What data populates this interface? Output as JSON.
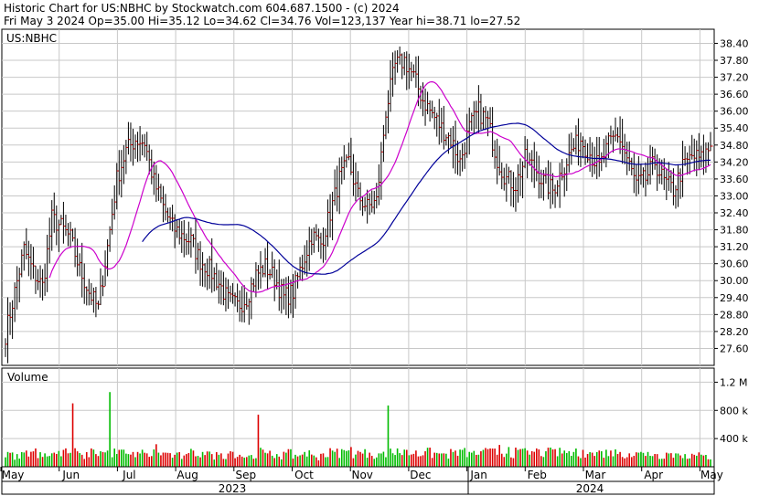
{
  "header": {
    "line1": "Historic Chart for US:NBHC by Stockwatch.com 604.687.1500 - (c) 2024",
    "line2": "Fri May  3 2024   Op=35.00  Hi=35.12  Lo=34.62  Cl=34.76  Vol=123,137  Year hi=38.71  lo=27.52"
  },
  "price_panel": {
    "label": "US:NBHC"
  },
  "volume_panel": {
    "label": "Volume"
  },
  "colors": {
    "bar": "#000000",
    "bar_tick": "#cc0000",
    "ma_short": "#cc00cc",
    "ma_long": "#000099",
    "vol_up": "#00bb00",
    "vol_down": "#dd0000",
    "grid": "#c8c8c8",
    "frame": "#000000"
  },
  "chart_data": [
    {
      "type": "line",
      "subtype": "ohlc-bars-with-moving-averages",
      "ylim": [
        27.0,
        38.9
      ],
      "y_ticks": [
        "38.40",
        "37.80",
        "37.20",
        "36.60",
        "36.00",
        "35.40",
        "34.80",
        "34.20",
        "33.60",
        "33.00",
        "32.40",
        "31.80",
        "31.20",
        "30.60",
        "30.00",
        "29.40",
        "28.80",
        "28.20",
        "27.60"
      ],
      "x_ticks": [
        "May",
        "Jun",
        "Jul",
        "Aug",
        "Sep",
        "Oct",
        "Nov",
        "Dec",
        "Jan",
        "Feb",
        "Mar",
        "Apr",
        "May"
      ],
      "year_labels": [
        "2023",
        "2024"
      ],
      "grid": true,
      "weekly_closes": [
        28.1,
        29.6,
        31.1,
        30.3,
        29.8,
        32.2,
        31.9,
        31.5,
        30.4,
        29.6,
        29.0,
        31.2,
        33.6,
        34.6,
        35.0,
        34.9,
        33.5,
        32.6,
        31.9,
        31.6,
        31.4,
        30.7,
        30.4,
        29.9,
        29.3,
        29.1,
        29.4,
        30.2,
        30.5,
        30.1,
        29.4,
        29.6,
        30.6,
        31.6,
        31.3,
        32.4,
        33.6,
        34.2,
        33.0,
        32.6,
        32.8,
        36.0,
        37.6,
        37.8,
        37.2,
        36.4,
        35.9,
        35.4,
        35.0,
        34.2,
        35.4,
        36.0,
        35.6,
        34.3,
        33.6,
        33.4,
        34.3,
        34.0,
        33.5,
        33.2,
        33.9,
        34.6,
        35.0,
        34.5,
        34.0,
        34.8,
        35.2,
        34.3,
        33.4,
        33.6,
        34.2,
        33.5,
        33.2,
        34.0,
        34.4,
        34.3,
        34.76
      ],
      "volume_k": [
        210,
        180,
        230,
        260,
        190,
        200,
        240,
        900,
        170,
        260,
        220,
        1060,
        240,
        180,
        210,
        190,
        320,
        200,
        170,
        160,
        230,
        210,
        180,
        190,
        220,
        170,
        160,
        740,
        190,
        180,
        200,
        170,
        210,
        160,
        190,
        230,
        250,
        280,
        210,
        200,
        190,
        870,
        260,
        240,
        230,
        220,
        200,
        190,
        210,
        240,
        200,
        220,
        260,
        310,
        280,
        240,
        230,
        260,
        220,
        250,
        230,
        210,
        240,
        200,
        220,
        230,
        210,
        190,
        200,
        210,
        180,
        200,
        190,
        180,
        170,
        160,
        150
      ]
    },
    {
      "type": "bar",
      "title": "Volume",
      "y_ticks": [
        "1.2 M",
        "800 k",
        "400 k"
      ],
      "ylim": [
        0,
        1400
      ]
    }
  ]
}
